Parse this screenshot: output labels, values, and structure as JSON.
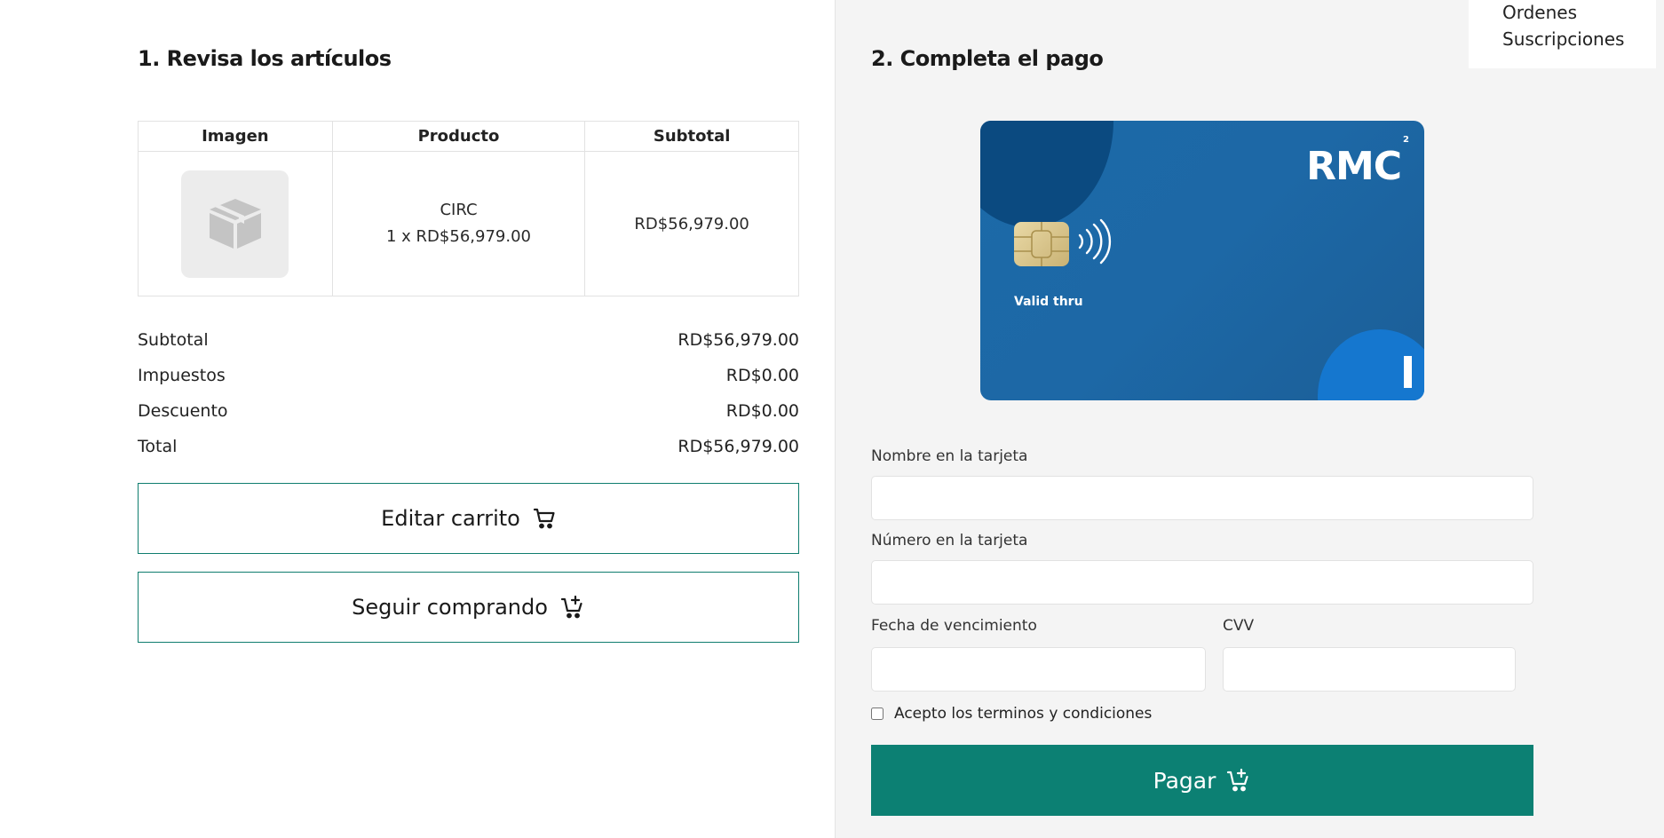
{
  "review": {
    "title": "1. Revisa los artículos",
    "table": {
      "headers": [
        "Imagen",
        "Producto",
        "Subtotal"
      ],
      "rows": [
        {
          "image_icon": "box-icon",
          "product_name": "CIRC",
          "product_qty": "1 x RD$56,979.00",
          "subtotal": "RD$56,979.00"
        }
      ]
    },
    "summary": [
      {
        "label": "Subtotal",
        "value": "RD$56,979.00"
      },
      {
        "label": "Impuestos",
        "value": "RD$0.00"
      },
      {
        "label": "Descuento",
        "value": "RD$0.00"
      },
      {
        "label": "Total",
        "value": "RD$56,979.00"
      }
    ],
    "edit_cart_label": "Editar carrito",
    "edit_cart_icon": "cart-icon",
    "continue_label": "Seguir comprando",
    "continue_icon": "cart-plus-icon"
  },
  "payment": {
    "title": "2. Completa el pago",
    "card": {
      "brand": "RMC",
      "brand_superscript": "2",
      "valid_thru": "Valid thru",
      "color": "#1c6aa8"
    },
    "fields": {
      "name_label": "Nombre en la tarjeta",
      "name_value": "",
      "number_label": "Número en la tarjeta",
      "number_value": "",
      "expiry_label": "Fecha de vencimiento",
      "expiry_value": "",
      "cvv_label": "CVV",
      "cvv_value": ""
    },
    "terms_label": "Acepto los terminos y condiciones",
    "terms_checked": false,
    "pay_label": "Pagar",
    "pay_icon": "cart-plus-icon",
    "accent_color": "#0c8073"
  },
  "user_menu": {
    "items": [
      "Ordenes",
      "Suscripciones"
    ]
  }
}
